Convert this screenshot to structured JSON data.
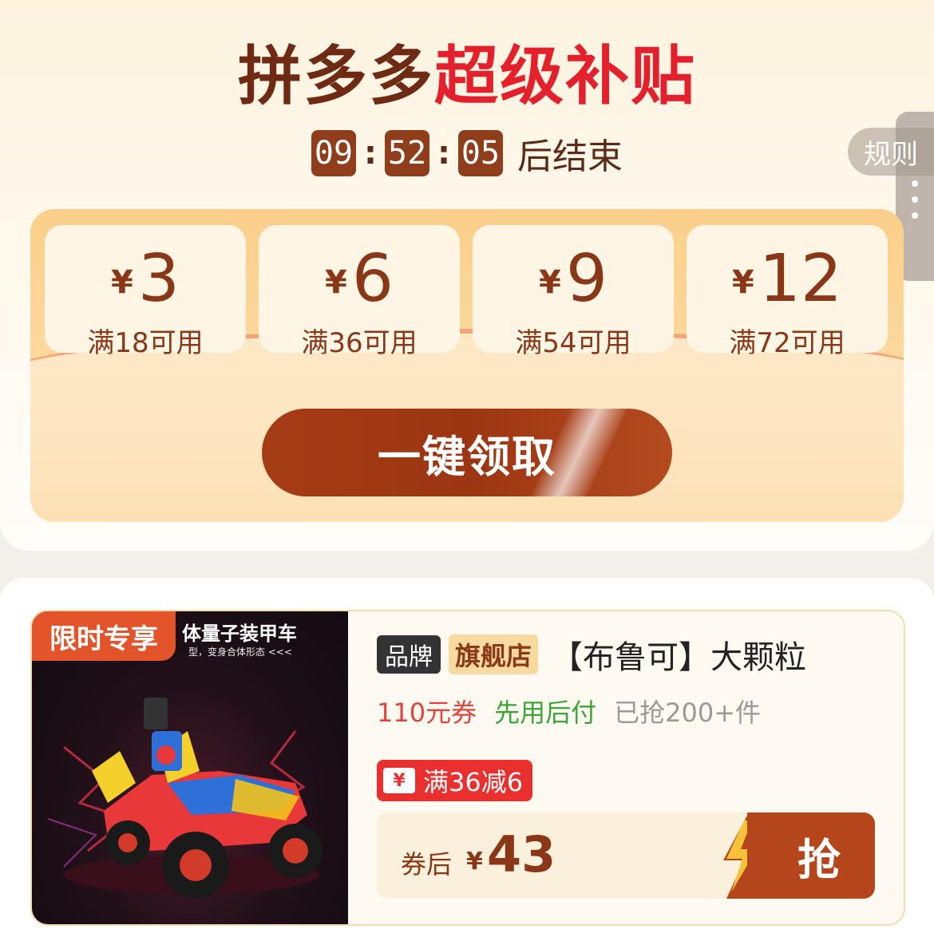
{
  "header": {
    "brand": "拼多多",
    "highlight": "超级补贴"
  },
  "countdown": {
    "hours": "09",
    "minutes": "52",
    "seconds": "05",
    "suffix": "后结束"
  },
  "rules_label": "规则",
  "coupons": [
    {
      "currency": "¥",
      "amount": "3",
      "condition": "满18可用"
    },
    {
      "currency": "¥",
      "amount": "6",
      "condition": "满36可用"
    },
    {
      "currency": "¥",
      "amount": "9",
      "condition": "满54可用"
    },
    {
      "currency": "¥",
      "amount": "12",
      "condition": "满72可用"
    }
  ],
  "claim_button": "一键领取",
  "product": {
    "limited_tag": "限时专享",
    "image_caption": "体量子装甲车",
    "image_subcaption": "型，变身合体形态 <<<",
    "brand_tag": "品牌",
    "store_tag": "旗舰店",
    "title": "【布鲁可】大颗粒",
    "coupon_text": "110元券",
    "pay_later": "先用后付",
    "sold": "已抢200+件",
    "discount_icon": "¥",
    "discount": "满36减6",
    "after_label": "券后",
    "currency": "¥",
    "price": "43",
    "grab_button": "抢"
  },
  "colors": {
    "brand_dark": "#6e2a12",
    "highlight_red": "#e3202c",
    "button_brown": "#a53c16",
    "pay_later_green": "#3aa638",
    "discount_red": "#ea2f2f"
  }
}
